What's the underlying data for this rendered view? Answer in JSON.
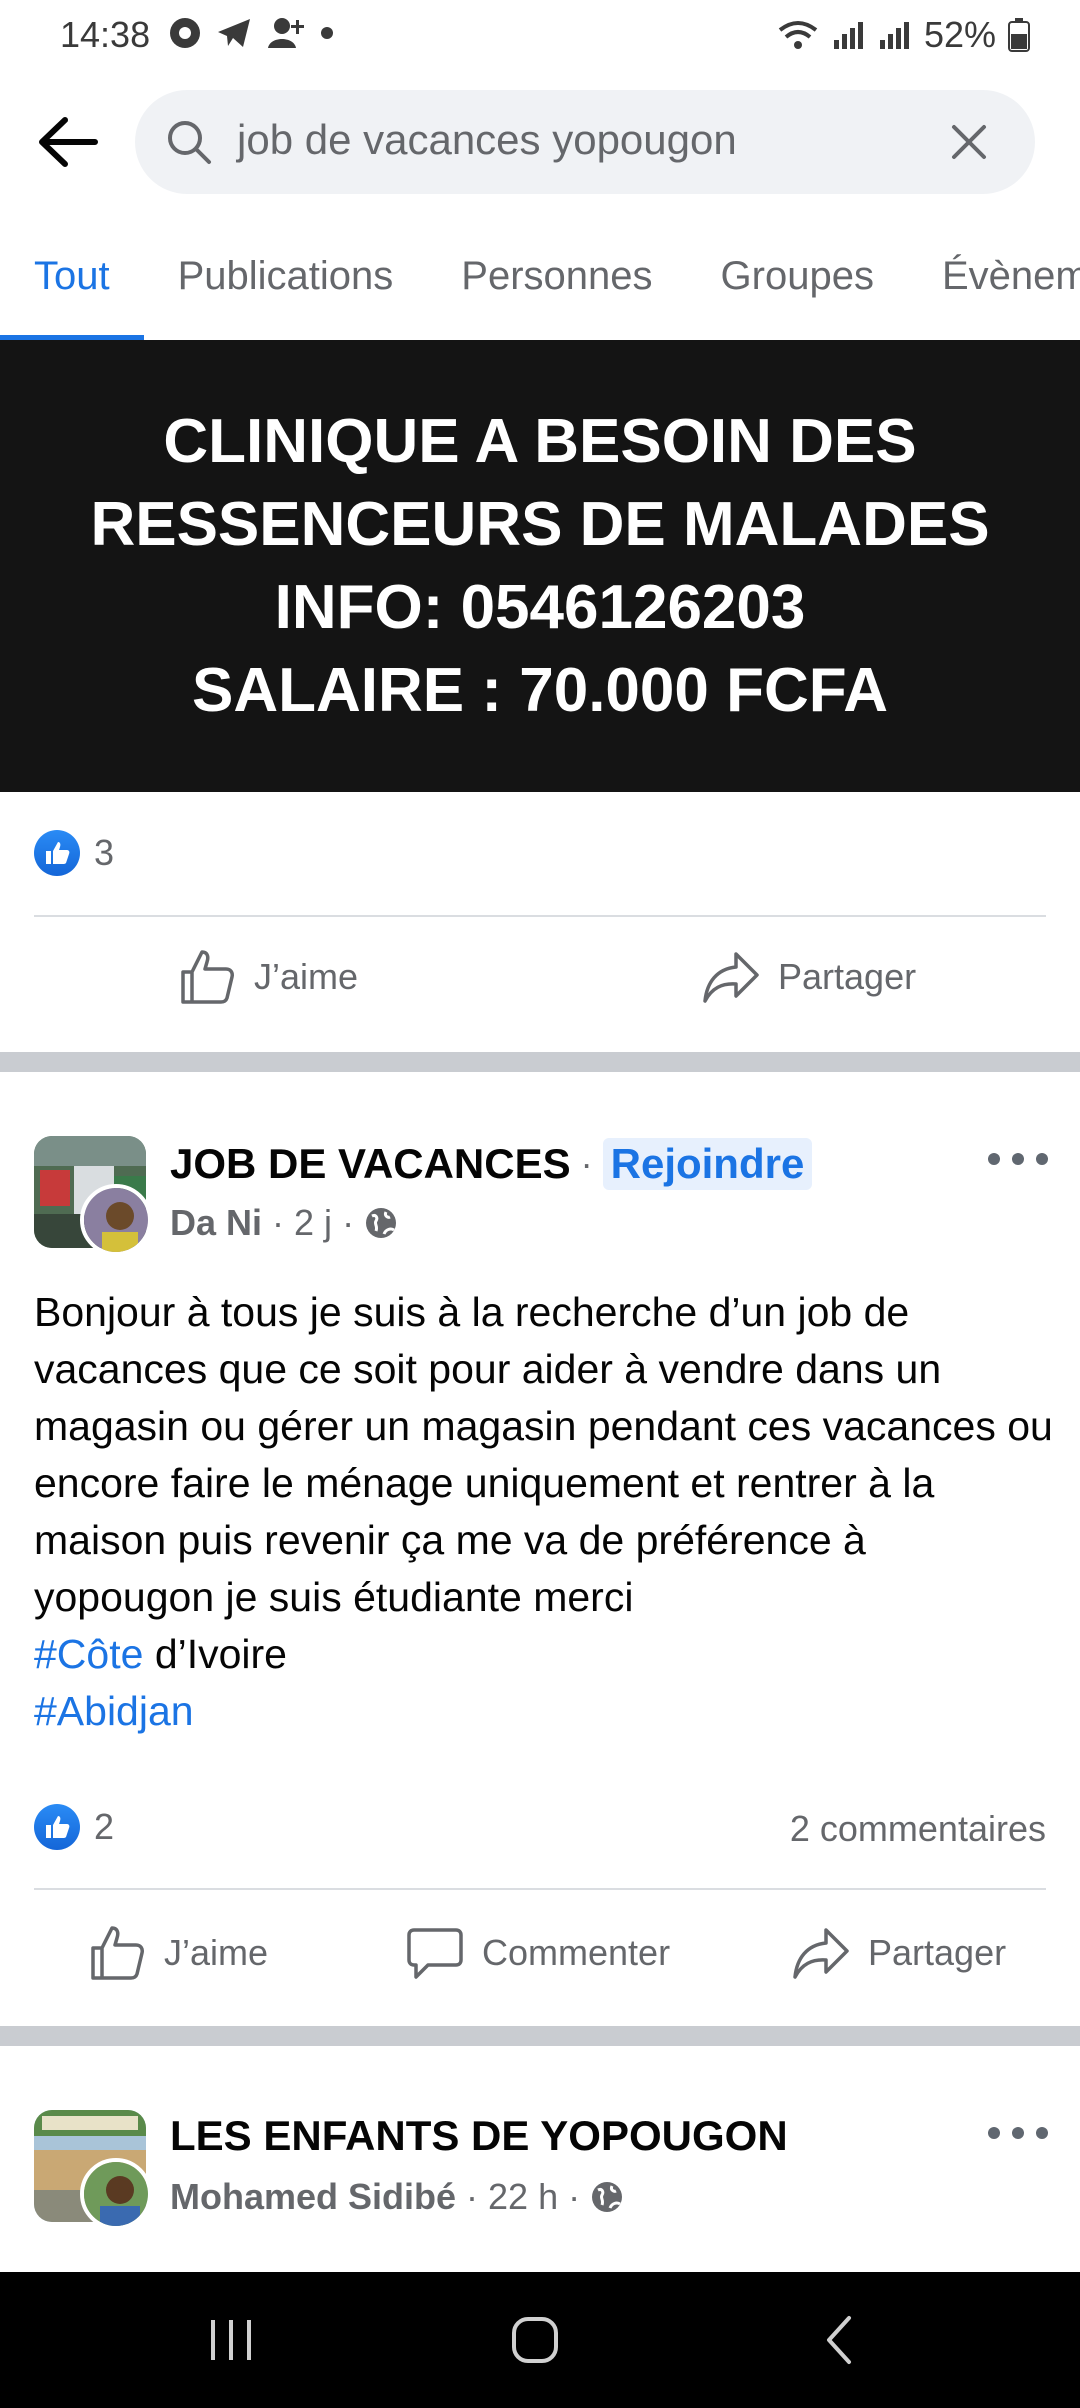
{
  "status_bar": {
    "time": "14:38",
    "battery": "52%",
    "icons_left": [
      "soccer-icon",
      "telegram-icon",
      "add-person-icon",
      "dot-icon"
    ],
    "icons_right": [
      "wifi-icon",
      "signal-icon",
      "signal-icon",
      "battery-icon"
    ]
  },
  "search": {
    "query": "job de vacances yopougon"
  },
  "tabs": [
    {
      "label": "Tout",
      "active": true
    },
    {
      "label": "Publications",
      "active": false
    },
    {
      "label": "Personnes",
      "active": false
    },
    {
      "label": "Groupes",
      "active": false
    },
    {
      "label": "Évènements",
      "active": false
    }
  ],
  "banner_post": {
    "lines": [
      "CLINIQUE A BESOIN DES",
      "RESSENCEURS DE MALADES",
      "INFO: 0546126203",
      "SALAIRE : 70.000 FCFA"
    ],
    "reactions_count": "3",
    "actions": {
      "like": "J’aime",
      "share": "Partager"
    }
  },
  "post1": {
    "group": "JOB DE VACANCES",
    "join": "Rejoindre",
    "author": "Da  Ni",
    "time": "2 j",
    "body": "Bonjour à tous je suis à la recherche d’un job de vacances que ce soit pour aider à vendre dans un magasin ou gérer un magasin pendant ces vacances ou encore faire le ménage uniquement et rentrer à la maison puis revenir ça me va de préférence à yopougon je suis étudiante merci",
    "hashtag1": "#Côte",
    "hashtag1_rest": " d’Ivoire",
    "hashtag2": "#Abidjan",
    "reactions_count": "2",
    "comments": "2 commentaires",
    "actions": {
      "like": "J’aime",
      "comment": "Commenter",
      "share": "Partager"
    }
  },
  "post2": {
    "group": "LES ENFANTS DE YOPOUGON",
    "author": "Mohamed Sidibé",
    "time": "22 h"
  },
  "colors": {
    "accent": "#1b74e4",
    "secondary_text": "#65676b",
    "banner_bg": "#141414",
    "separator": "#c9ccd1"
  }
}
